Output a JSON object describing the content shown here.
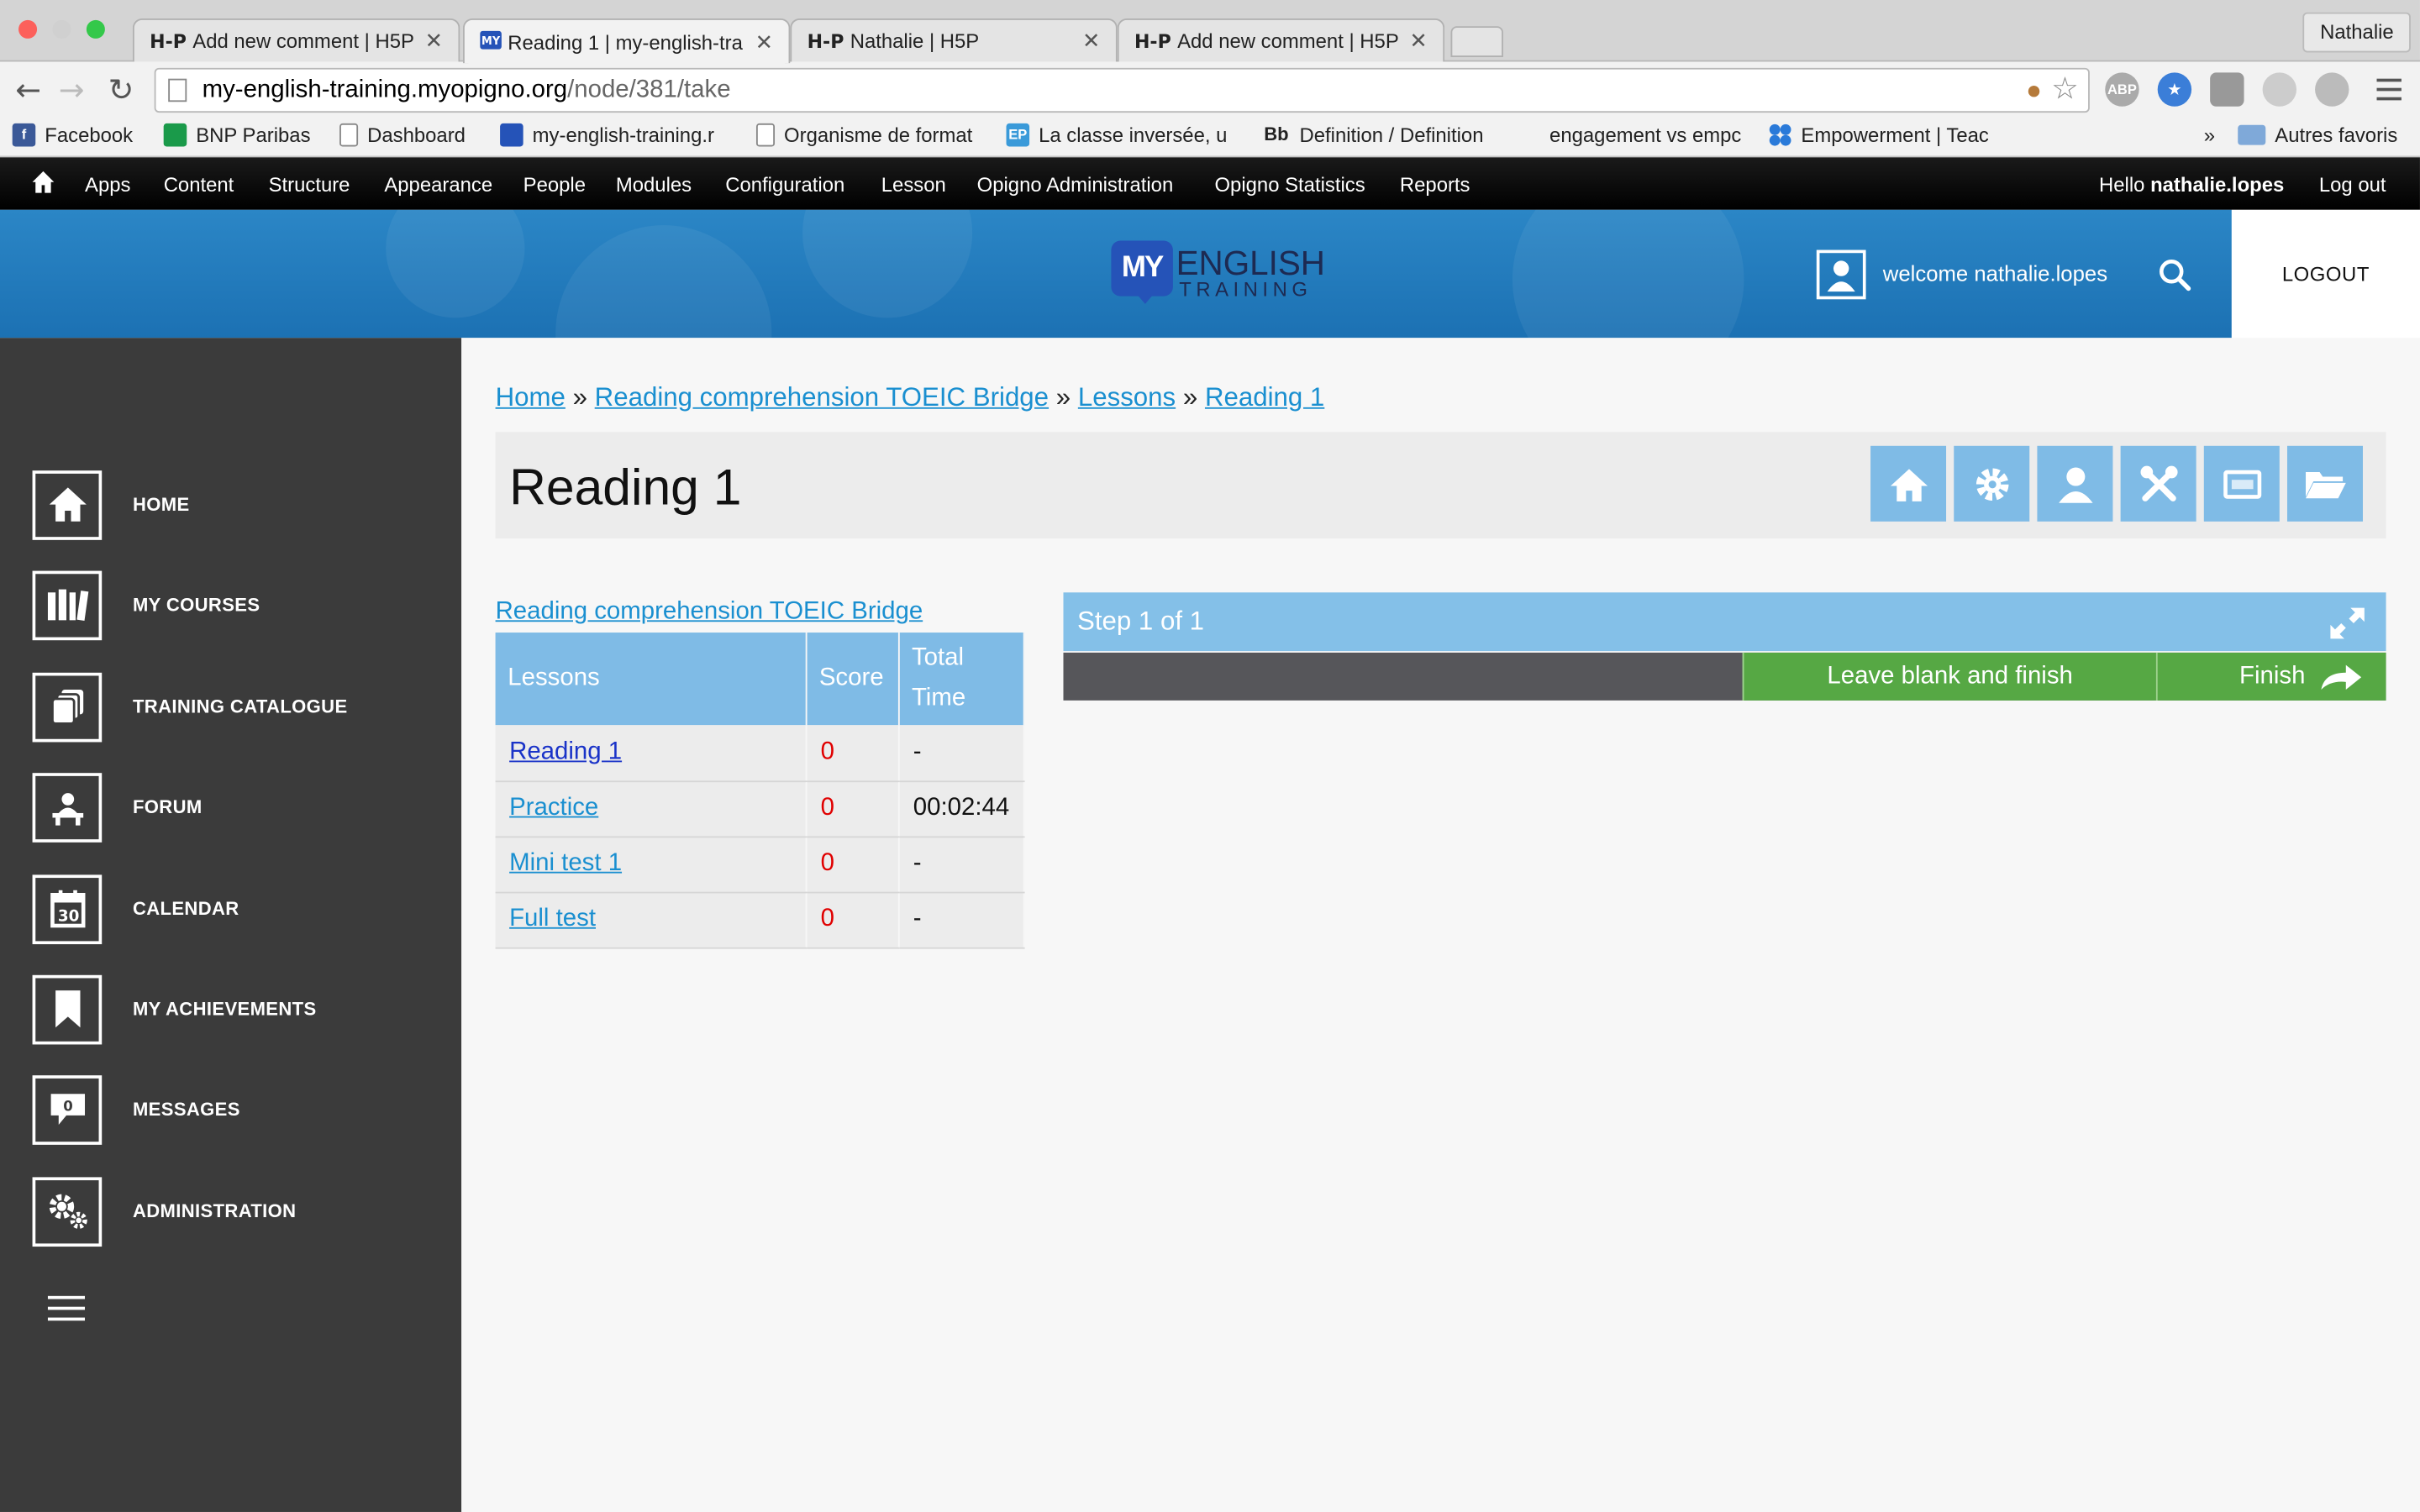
{
  "browser": {
    "tabs": [
      {
        "favicon": "H-P",
        "title": "Add new comment | H5P"
      },
      {
        "favicon": "site",
        "title": "Reading 1 | my-english-tra"
      },
      {
        "favicon": "H-P",
        "title": "Nathalie | H5P"
      },
      {
        "favicon": "H-P",
        "title": "Add new comment | H5P"
      }
    ],
    "profile_name": "Nathalie",
    "url_host": "my-english-training.myopigno.org",
    "url_path": "/node/381/take",
    "extensions": [
      "ABP"
    ],
    "bookmarks": [
      {
        "label": "Facebook",
        "icon": "facebook-icon",
        "color": "#3b5998"
      },
      {
        "label": "BNP Paribas",
        "icon": "bnp-icon",
        "color": "#1a9a4a"
      },
      {
        "label": "Dashboard",
        "icon": "page-icon",
        "color": "#888888"
      },
      {
        "label": "my-english-training.r",
        "icon": "site-icon",
        "color": "#2553b8"
      },
      {
        "label": "Organisme de format",
        "icon": "page-icon",
        "color": "#888888"
      },
      {
        "label": "La classe inversée, u",
        "icon": "ep-icon",
        "color": "#3a9ad9"
      },
      {
        "label": "Definition / Definition",
        "icon": "bb-icon",
        "color": "#222222"
      },
      {
        "label": "engagement vs empc",
        "icon": "none",
        "color": "#ffffff"
      },
      {
        "label": "Empowerment | Teac",
        "icon": "clover-icon",
        "color": "#2a7ad9"
      }
    ],
    "bookmarks_more": "»",
    "other_bookmarks": "Autres favoris"
  },
  "adminbar": {
    "items": [
      "Apps",
      "Content",
      "Structure",
      "Appearance",
      "People",
      "Modules",
      "Configuration",
      "Lesson",
      "Opigno Administration",
      "Opigno Statistics",
      "Reports"
    ],
    "hello_prefix": "Hello ",
    "username": "nathalie.lopes",
    "logout": "Log out"
  },
  "header": {
    "logo_my": "MY",
    "logo_english": "ENGLISH",
    "logo_training": "TRAINING",
    "welcome": "welcome nathalie.lopes",
    "logout": "LOGOUT"
  },
  "sidebar": {
    "items": [
      {
        "label": "HOME",
        "icon": "home-icon"
      },
      {
        "label": "MY COURSES",
        "icon": "books-icon"
      },
      {
        "label": "TRAINING CATALOGUE",
        "icon": "catalogue-icon"
      },
      {
        "label": "FORUM",
        "icon": "forum-icon"
      },
      {
        "label": "CALENDAR",
        "icon": "calendar-icon",
        "badge": "30"
      },
      {
        "label": "MY ACHIEVEMENTS",
        "icon": "bookmark-icon"
      },
      {
        "label": "MESSAGES",
        "icon": "messages-icon",
        "badge": "0"
      },
      {
        "label": "ADMINISTRATION",
        "icon": "gears-icon"
      }
    ]
  },
  "breadcrumb": {
    "items": [
      "Home",
      "Reading comprehension TOEIC Bridge",
      "Lessons",
      "Reading 1"
    ],
    "separator": "»"
  },
  "page": {
    "title": "Reading 1",
    "title_buttons": [
      "home-icon",
      "gear-icon",
      "user-icon",
      "tools-icon",
      "screen-icon",
      "folder-icon"
    ]
  },
  "course": {
    "title": "Reading comprehension TOEIC Bridge",
    "columns": [
      "Lessons",
      "Score",
      "Total Time"
    ],
    "rows": [
      {
        "name": "Reading 1",
        "score": "0",
        "time": "-"
      },
      {
        "name": "Practice",
        "score": "0",
        "time": "00:02:44"
      },
      {
        "name": "Mini test 1",
        "score": "0",
        "time": "-"
      },
      {
        "name": "Full test",
        "score": "0",
        "time": "-"
      }
    ]
  },
  "quiz": {
    "step": "Step 1 of 1",
    "leave_blank": "Leave blank and finish",
    "finish": "Finish"
  },
  "colors": {
    "accent_blue": "#7fbbe6",
    "link_blue": "#1a8fd0",
    "sidebar_bg": "#3b3b3b",
    "finish_green": "#56a844",
    "score_red": "#e00000"
  }
}
